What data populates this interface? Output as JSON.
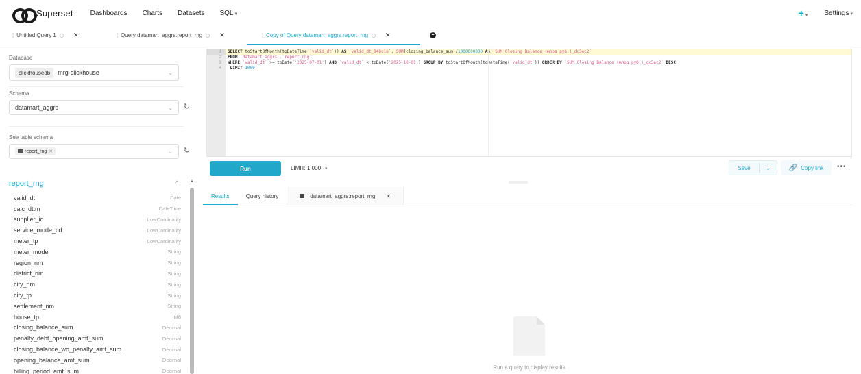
{
  "nav": {
    "brand": "Superset",
    "links": [
      "Dashboards",
      "Charts",
      "Datasets",
      "SQL"
    ],
    "plus": "+",
    "settings": "Settings"
  },
  "tabs": [
    {
      "label": "Untitled Query 1"
    },
    {
      "label": "Query datamart_aggrs.report_rng"
    },
    {
      "label": "Copy of Query datamart_aggrs.report_rng"
    }
  ],
  "left": {
    "database_label": "Database",
    "database_tag": "clickhousedb",
    "database_value": "mrg-clickhouse",
    "schema_label": "Schema",
    "schema_value": "datamart_aggrs",
    "table_schema_label": "See table schema",
    "table_tag": "report_rng",
    "table_name": "report_rng",
    "columns": [
      {
        "name": "valid_dt",
        "type": "Date"
      },
      {
        "name": "calc_dttm",
        "type": "DateTime"
      },
      {
        "name": "supplier_id",
        "type": "LowCardinality"
      },
      {
        "name": "service_mode_cd",
        "type": "LowCardinality"
      },
      {
        "name": "meter_tp",
        "type": "LowCardinality"
      },
      {
        "name": "meter_model",
        "type": "String"
      },
      {
        "name": "region_nm",
        "type": "String"
      },
      {
        "name": "district_nm",
        "type": "String"
      },
      {
        "name": "city_nm",
        "type": "String"
      },
      {
        "name": "city_tp",
        "type": "String"
      },
      {
        "name": "settlement_nm",
        "type": "String"
      },
      {
        "name": "house_tp",
        "type": "Int8"
      },
      {
        "name": "closing_balance_sum",
        "type": "Decimal"
      },
      {
        "name": "penalty_debt_opening_amt_sum",
        "type": "Decimal"
      },
      {
        "name": "closing_balance_wo_penalty_amt_sum",
        "type": "Decimal"
      },
      {
        "name": "opening_balance_amt_sum",
        "type": "Decimal"
      },
      {
        "name": "billing_period_amt_sum",
        "type": "Decimal"
      }
    ]
  },
  "editor": {
    "line_numbers": [
      "1",
      "2",
      "3",
      "4"
    ],
    "line1": {
      "kw1": "SELECT",
      "t1": " toStartOfMonth(toDateTime(",
      "s1": "`valid_dt`",
      "t2": ")) ",
      "kw2": "AS",
      "t3": " ",
      "s2": "`valid_dt_848c1e`",
      "t4": ", ",
      "s3": "SUM",
      "t5": "(closing_balance_sum)/",
      "n1": "1000000000",
      "t6": " ",
      "kw3": "AS",
      "t7": " ",
      "s4": "`SUM Closing Balance (млрд руб.)_dc5ec2`"
    },
    "line2": {
      "kw1": "FROM",
      "t1": " ",
      "s1": "`datamart_aggrs`.`report_rng`"
    },
    "line3": {
      "kw1": "WHERE",
      "t1": " ",
      "s1": "`valid_dt`",
      "t2": " >= toDate(",
      "s2": "'2025-07-01'",
      "t3": ") ",
      "kw2": "AND",
      "t4": " ",
      "s3": "`valid_dt`",
      "t5": " < toDate(",
      "s4": "'2025-10-01'",
      "t6": ") ",
      "kw3": "GROUP BY",
      "t7": " toStartOfMonth(toDateTime(",
      "s5": "`valid_dt`",
      "t8": ")) ",
      "kw4": "ORDER BY",
      "t9": " ",
      "s6": "`SUM Closing Balance (млрд руб.)_dc5ec2`",
      "t10": " ",
      "kw5": "DESC"
    },
    "line4": {
      "kw1": " LIMIT",
      "t1": " ",
      "n1": "1000",
      "t2": ";"
    }
  },
  "toolbar": {
    "run": "Run",
    "limit": "LIMIT: 1 000",
    "save": "Save",
    "copy_link": "Copy link",
    "more": "•••"
  },
  "results": {
    "tabs": [
      "Results",
      "Query history",
      "datamart_aggrs.report_rng"
    ],
    "empty_text": "Run a query to display results"
  }
}
